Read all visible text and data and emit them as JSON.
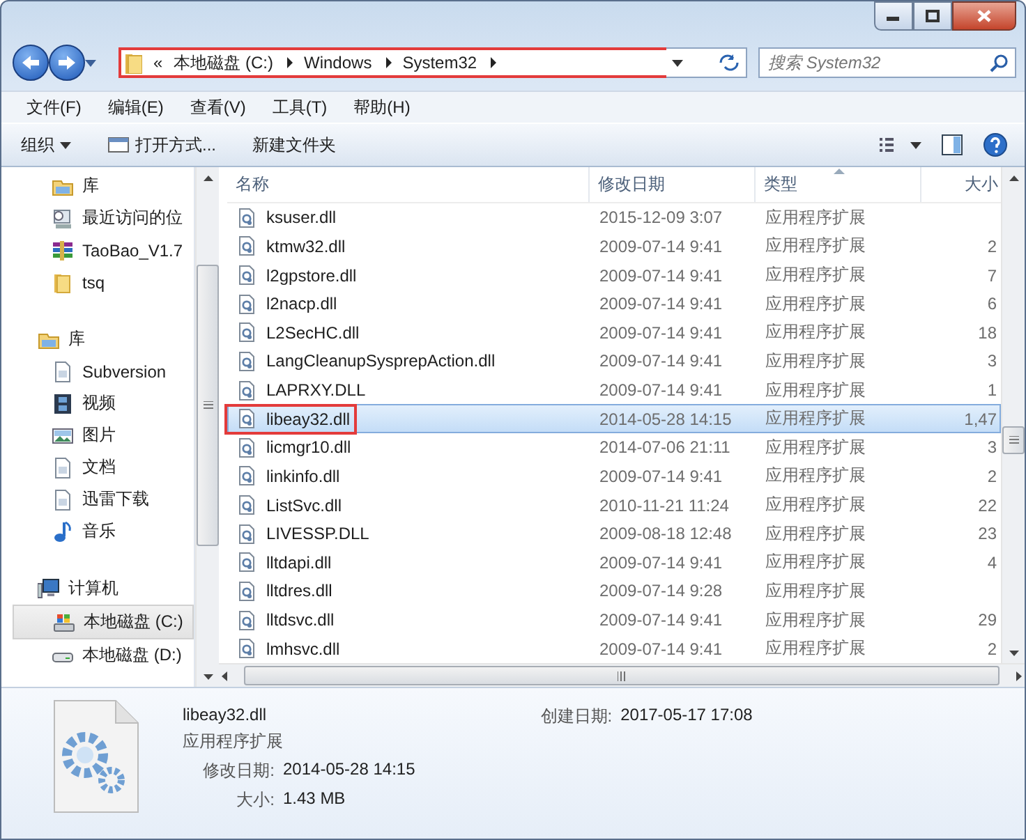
{
  "window": {
    "controls": [
      {
        "kind": "minimize"
      },
      {
        "kind": "maximize"
      },
      {
        "kind": "close"
      }
    ]
  },
  "address_bar": {
    "highlighted": true,
    "overflow": "«",
    "crumbs": [
      "本地磁盘 (C:)",
      "Windows",
      "System32"
    ]
  },
  "search": {
    "placeholder": "搜索 System32"
  },
  "menu": [
    "文件(F)",
    "编辑(E)",
    "查看(V)",
    "工具(T)",
    "帮助(H)"
  ],
  "commands": [
    {
      "label": "组织",
      "kind": "dropdown"
    },
    {
      "label": "打开方式...",
      "kind": "open"
    },
    {
      "label": "新建文件夹",
      "kind": "plain"
    }
  ],
  "sidebar": {
    "sections": [
      {
        "items": [
          {
            "label": "库",
            "kind": "library",
            "selected": false
          },
          {
            "label": "最近访问的位",
            "kind": "recent",
            "selected": false
          },
          {
            "label": "TaoBao_V1.7",
            "kind": "archive",
            "selected": false
          },
          {
            "label": "tsq",
            "kind": "folder",
            "selected": false
          }
        ]
      },
      {
        "label": "库",
        "kind": "library",
        "children": [
          {
            "label": "Subversion",
            "kind": "doc",
            "selected": false
          },
          {
            "label": "视频",
            "kind": "video",
            "selected": false
          },
          {
            "label": "图片",
            "kind": "picture",
            "selected": false
          },
          {
            "label": "文档",
            "kind": "doc",
            "selected": false
          },
          {
            "label": "迅雷下载",
            "kind": "doc",
            "selected": false
          },
          {
            "label": "音乐",
            "kind": "music",
            "selected": false
          }
        ]
      },
      {
        "label": "计算机",
        "kind": "computer",
        "children": [
          {
            "label": "本地磁盘 (C:)",
            "kind": "windisk",
            "selected": true
          },
          {
            "label": "本地磁盘 (D:)",
            "kind": "disk",
            "selected": false
          }
        ]
      }
    ]
  },
  "table": {
    "columns": [
      "名称",
      "修改日期",
      "类型",
      "大小"
    ],
    "rows": [
      {
        "name": "ksuser.dll",
        "date": "2015-12-09 3:07",
        "type": "应用程序扩展",
        "selected": false,
        "highlighted": false
      },
      {
        "name": "ktmw32.dll",
        "date": "2009-07-14 9:41",
        "type": "应用程序扩展",
        "size": "2",
        "selected": false,
        "highlighted": false
      },
      {
        "name": "l2gpstore.dll",
        "date": "2009-07-14 9:41",
        "type": "应用程序扩展",
        "size": "7",
        "selected": false,
        "highlighted": false
      },
      {
        "name": "l2nacp.dll",
        "date": "2009-07-14 9:41",
        "type": "应用程序扩展",
        "size": "6",
        "selected": false,
        "highlighted": false
      },
      {
        "name": "L2SecHC.dll",
        "date": "2009-07-14 9:41",
        "type": "应用程序扩展",
        "size": "18",
        "selected": false,
        "highlighted": false
      },
      {
        "name": "LangCleanupSysprepAction.dll",
        "date": "2009-07-14 9:41",
        "type": "应用程序扩展",
        "size": "3",
        "selected": false,
        "highlighted": false
      },
      {
        "name": "LAPRXY.DLL",
        "date": "2009-07-14 9:41",
        "type": "应用程序扩展",
        "size": "1",
        "selected": false,
        "highlighted": false
      },
      {
        "name": "libeay32.dll",
        "date": "2014-05-28 14:15",
        "type": "应用程序扩展",
        "size": "1,47",
        "selected": true,
        "highlighted": true
      },
      {
        "name": "licmgr10.dll",
        "date": "2014-07-06 21:11",
        "type": "应用程序扩展",
        "size": "3",
        "selected": false,
        "highlighted": false
      },
      {
        "name": "linkinfo.dll",
        "date": "2009-07-14 9:41",
        "type": "应用程序扩展",
        "size": "2",
        "selected": false,
        "highlighted": false
      },
      {
        "name": "ListSvc.dll",
        "date": "2010-11-21 11:24",
        "type": "应用程序扩展",
        "size": "22",
        "selected": false,
        "highlighted": false
      },
      {
        "name": "LIVESSP.DLL",
        "date": "2009-08-18 12:48",
        "type": "应用程序扩展",
        "size": "23",
        "selected": false,
        "highlighted": false
      },
      {
        "name": "lltdapi.dll",
        "date": "2009-07-14 9:41",
        "type": "应用程序扩展",
        "size": "4",
        "selected": false,
        "highlighted": false
      },
      {
        "name": "lltdres.dll",
        "date": "2009-07-14 9:28",
        "type": "应用程序扩展",
        "selected": false,
        "highlighted": false
      },
      {
        "name": "lltdsvc.dll",
        "date": "2009-07-14 9:41",
        "type": "应用程序扩展",
        "size": "29",
        "selected": false,
        "highlighted": false
      },
      {
        "name": "lmhsvc.dll",
        "date": "2009-07-14 9:41",
        "type": "应用程序扩展",
        "size": "2",
        "selected": false,
        "highlighted": false
      }
    ]
  },
  "details": {
    "name": "libeay32.dll",
    "type": "应用程序扩展",
    "fields": [
      {
        "label": "修改日期:",
        "value": "2014-05-28 14:15"
      },
      {
        "label": "大小:",
        "value": "1.43 MB"
      }
    ],
    "created": {
      "label": "创建日期:",
      "value": "2017-05-17 17:08"
    }
  }
}
